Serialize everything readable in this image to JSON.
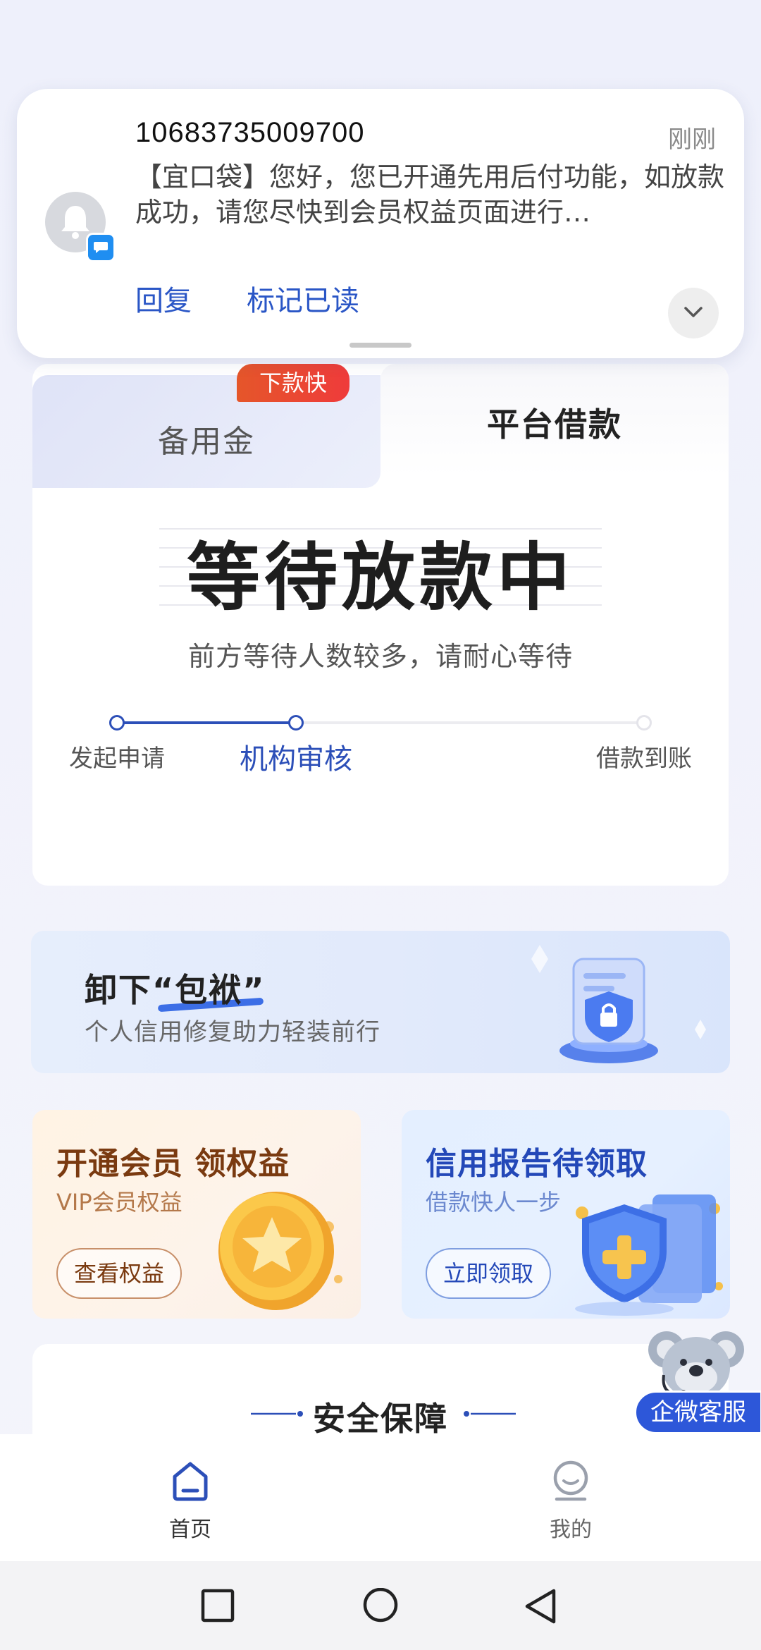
{
  "notification": {
    "sender": "10683735009700",
    "time": "刚刚",
    "body": "【宜口袋】您好，您已开通先用后付功能，如放款成功，请您尽快到会员权益页面进行…",
    "action_reply": "回复",
    "action_mark_read": "标记已读",
    "icon": "bell-icon",
    "badge_icon": "message-icon"
  },
  "loan": {
    "tab_reserve": "备用金",
    "tab_reserve_ribbon": "下款快",
    "tab_platform": "平台借款",
    "status_title": "等待放款中",
    "status_subtitle": "前方等待人数较多，请耐心等待",
    "steps": [
      "发起申请",
      "机构审核",
      "借款到账"
    ],
    "current_step": 2,
    "accent_color": "#2c4fb8"
  },
  "banner": {
    "title": "卸下“包袱”",
    "subtitle": "个人信用修复助力轻装前行"
  },
  "cards": {
    "vip": {
      "title": "开通会员 领权益",
      "subtitle": "VIP会员权益",
      "button": "查看权益"
    },
    "credit": {
      "title": "信用报告待领取",
      "subtitle": "借款快人一步",
      "button": "立即领取"
    }
  },
  "security": {
    "title": "安全保障"
  },
  "service": {
    "label": "企微客服"
  },
  "nav": {
    "home": "首页",
    "mine": "我的"
  }
}
